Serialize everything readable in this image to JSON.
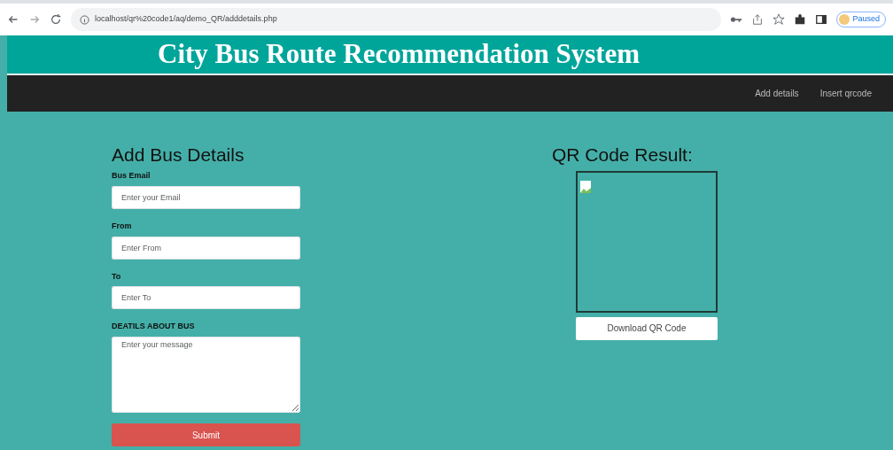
{
  "browser": {
    "url": "localhost/qr%20code1/aq/demo_QR/adddetails.php",
    "profile": "Paused"
  },
  "header": {
    "title": "City Bus Route Recommendation System"
  },
  "nav": [
    {
      "label": "Add details"
    },
    {
      "label": "Insert qrcode"
    }
  ],
  "form": {
    "heading": "Add Bus Details",
    "fields": [
      {
        "kind": "input",
        "label": "Bus Email",
        "placeholder": "Enter your Email"
      },
      {
        "kind": "input",
        "label": "From",
        "placeholder": "Enter From"
      },
      {
        "kind": "input",
        "label": "To",
        "placeholder": "Enter To"
      },
      {
        "kind": "textarea",
        "label": "DEATILS ABOUT BUS",
        "placeholder": "Enter your message"
      }
    ],
    "submit": "Submit"
  },
  "qr": {
    "heading": "QR Code Result:",
    "download": "Download QR Code"
  }
}
